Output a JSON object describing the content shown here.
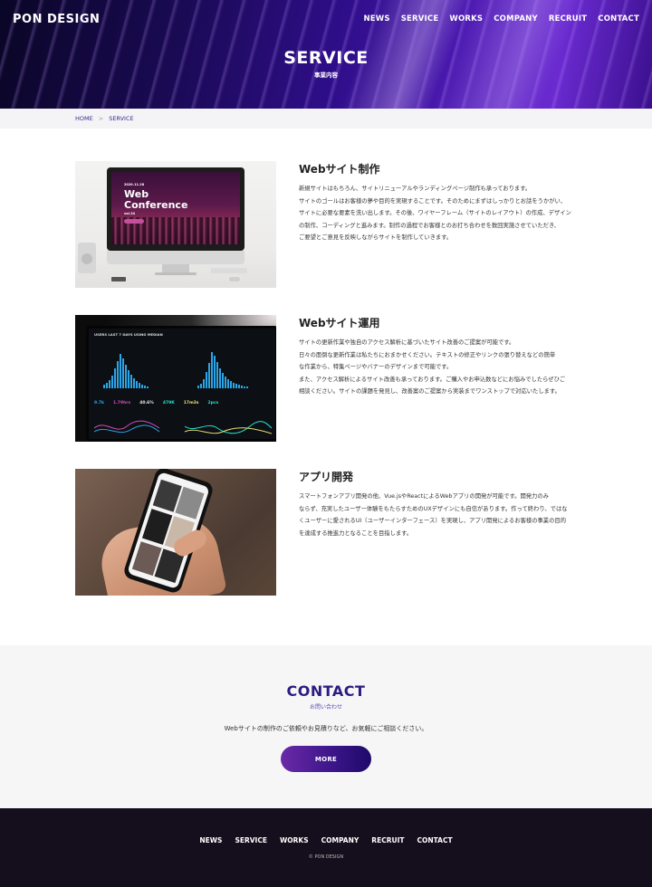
{
  "header": {
    "logo": "PON DESIGN",
    "nav": [
      "NEWS",
      "SERVICE",
      "WORKS",
      "COMPANY",
      "RECRUIT",
      "CONTACT"
    ]
  },
  "hero": {
    "title": "SERVICE",
    "subtitle": "事業内容"
  },
  "breadcrumb": {
    "home": "HOME",
    "separator": ">",
    "current": "SERVICE"
  },
  "services": [
    {
      "title": "Webサイト制作",
      "lines": [
        "新規サイトはもちろん、サイトリニューアルやランディングページ制作も承っております。",
        "サイトのゴールはお客様の夢や目的を実現することです。そのためにまずはしっかりとお話をうかがい、",
        "サイトに必要な要素を洗い出します。その後、ワイヤーフレーム（サイトのレイアウト）の作成、デザイン",
        "の制作、コーディングと進みます。制作の過程でお客様とのお打ち合わせを数回実施させていただき、",
        "ご要望とご意見を反映しながらサイトを制作していきます。"
      ],
      "image_icon": "imac-conference-image",
      "image_text": {
        "small": "2020.11.28",
        "big1": "Web",
        "big2": "Conference",
        "vol": "vol.24"
      }
    },
    {
      "title": "Webサイト運用",
      "lines": [
        "サイトの更新作業や独自のアクセス解析に基づいたサイト改善のご提案が可能です。",
        "日々の面倒な更新作業は私たちにおまかせください。テキストの修正やリンクの張り替えなどの簡単",
        "な作業から、特集ページやバナーのデザインまで可能です。",
        "また、アクセス解析によるサイト改善も承っております。ご購入やお申込数などにお悩みでしたらぜひご",
        "相談ください。サイトの課題を発見し、改善案のご提案から実装までワンストップで対応いたします。"
      ],
      "image_icon": "analytics-tablet-image",
      "image_text": {
        "dash": "USERS  LAST 7 DAYS  USING MEDIAN",
        "k1": "9.7k",
        "k2": "1.79hrs",
        "k3": "40.6%",
        "k4": "479K",
        "k5": "17m3s",
        "k6": "2pcs"
      }
    },
    {
      "title": "アプリ開発",
      "lines": [
        "スマートフォンアプリ開発の他、Vue.jsやReactによるWebアプリの開発が可能です。開発力のみ",
        "ならず、充実したユーザー体験をもたらすためのUXデザインにも自信があります。作って終わり、ではな",
        "くユーザーに愛されるUI（ユーザーインターフェース）を実現し、アプリ開発によるお客様の事業の目的",
        "を達成する推進力となることを目指します。"
      ],
      "image_icon": "smartphone-hand-image"
    }
  ],
  "contact": {
    "title": "CONTACT",
    "subtitle": "お問い合わせ",
    "description": "Webサイトの制作のご依頼やお見積りなど、お気軽にご相談ください。",
    "button": "MORE"
  },
  "footer": {
    "nav": [
      "NEWS",
      "SERVICE",
      "WORKS",
      "COMPANY",
      "RECRUIT",
      "CONTACT"
    ],
    "copyright": "© PON DESIGN"
  },
  "colors": {
    "accent": "#2d1b82",
    "button_start": "#6a2aa8",
    "button_end": "#1e0a6a",
    "footer_bg": "#150e1c"
  }
}
